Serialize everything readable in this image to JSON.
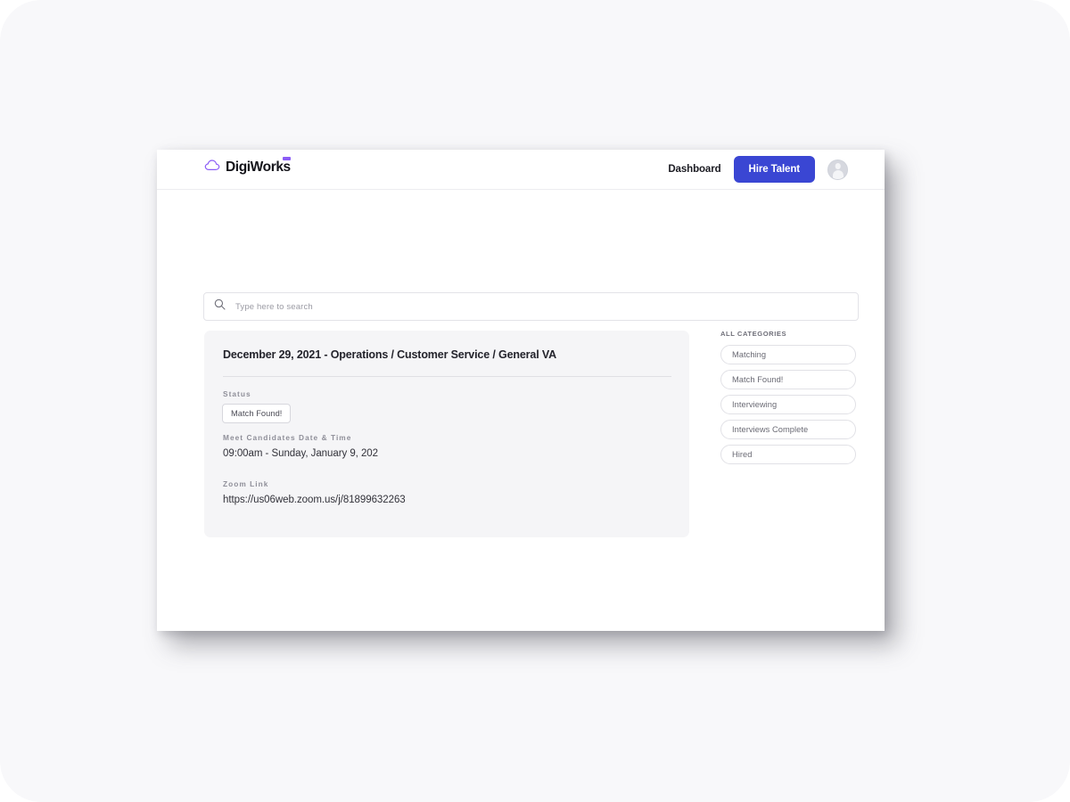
{
  "brand": {
    "name": "DigiWorks",
    "cloud_icon": "cloud-icon",
    "accent_color": "#8b5cf6"
  },
  "nav": {
    "dashboard_label": "Dashboard",
    "hire_talent_label": "Hire Talent",
    "hire_talent_color": "#3a46d3",
    "avatar_icon": "user-avatar-icon"
  },
  "search": {
    "icon": "search-icon",
    "placeholder": "Type here to search",
    "value": ""
  },
  "job_card": {
    "title": "December 29, 2021 - Operations / Customer Service / General VA",
    "fields": {
      "status_label": "Status",
      "status_value": "Match Found!",
      "meet_label": "Meet Candidates Date & Time",
      "meet_value": "09:00am - Sunday, January 9, 202",
      "zoom_label": "Zoom Link",
      "zoom_value": "https://us06web.zoom.us/j/81899632263"
    }
  },
  "categories": {
    "title": "ALL CATEGORIES",
    "items": [
      {
        "label": "Matching"
      },
      {
        "label": "Match Found!"
      },
      {
        "label": "Interviewing"
      },
      {
        "label": "Interviews Complete"
      },
      {
        "label": "Hired"
      }
    ]
  }
}
